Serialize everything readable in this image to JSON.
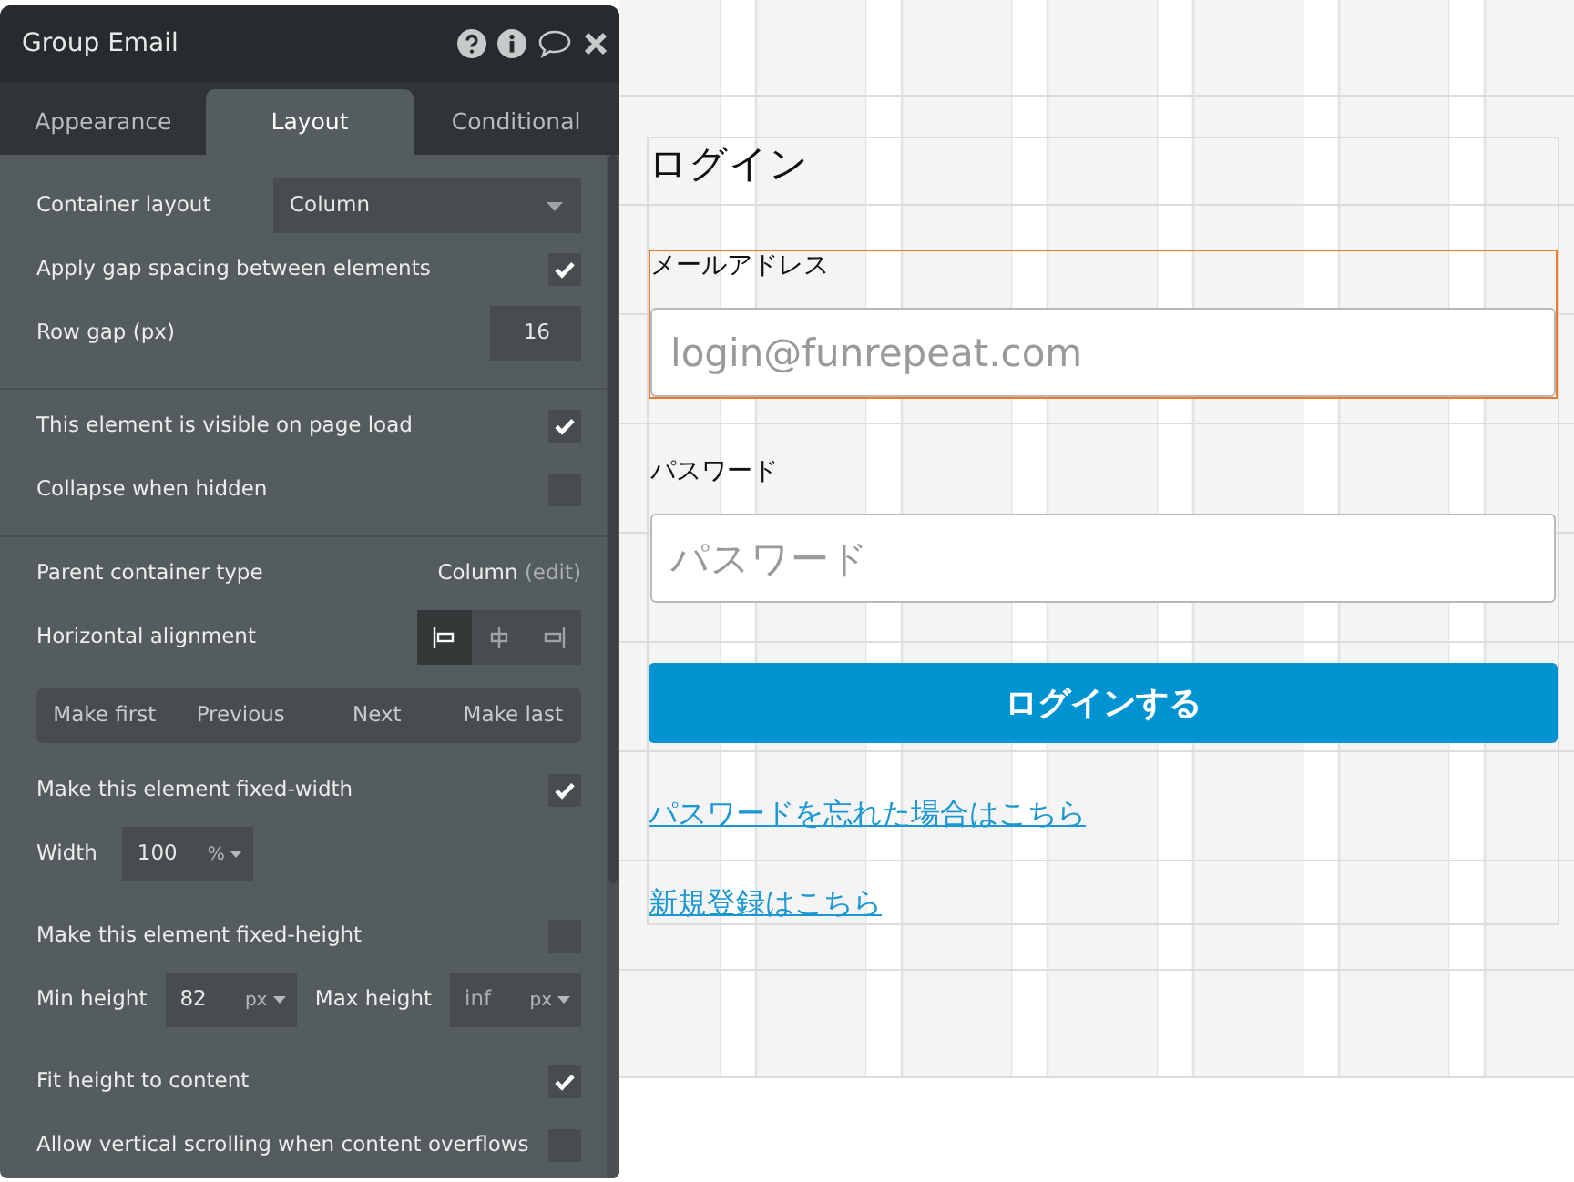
{
  "panel": {
    "title": "Group Email",
    "tabs": [
      {
        "label": "Appearance",
        "selected": false
      },
      {
        "label": "Layout",
        "selected": true
      },
      {
        "label": "Conditional",
        "selected": false
      }
    ],
    "rows": [
      {
        "kind": "select",
        "label": "Container layout",
        "value": "Column"
      },
      {
        "kind": "checkbox",
        "label": "Apply gap spacing between elements",
        "checked": true
      },
      {
        "kind": "number",
        "label": "Row gap (px)",
        "value": "16"
      },
      {
        "kind": "divider"
      },
      {
        "kind": "checkbox",
        "label": "This element is visible on page load",
        "checked": true
      },
      {
        "kind": "checkbox",
        "label": "Collapse when hidden",
        "checked": false
      },
      {
        "kind": "divider"
      },
      {
        "kind": "text",
        "label": "Parent container type",
        "value": "Column",
        "link": "(edit)"
      },
      {
        "kind": "alignment",
        "label": "Horizontal alignment",
        "options": [
          {
            "kind": "left",
            "selected": true
          },
          {
            "kind": "center",
            "selected": false
          },
          {
            "kind": "right",
            "selected": false
          }
        ]
      },
      {
        "kind": "buttons",
        "buttons": [
          "Make first",
          "Previous",
          "Next",
          "Make last"
        ]
      },
      {
        "kind": "checkbox",
        "label": "Make this element fixed-width",
        "checked": true
      },
      {
        "kind": "unit",
        "label": "Width",
        "value": "100",
        "unit": "%"
      },
      {
        "kind": "checkbox",
        "label": "Make this element fixed-height",
        "checked": false
      },
      {
        "kind": "minmax",
        "fields": [
          {
            "label": "Min height",
            "value": "82",
            "unit": "px"
          },
          {
            "label": "Max height",
            "placeholder": "inf",
            "unit": "px"
          }
        ]
      },
      {
        "kind": "checkbox",
        "label": "Fit height to content",
        "checked": true
      },
      {
        "kind": "checkbox",
        "label": "Allow vertical scrolling when content overflows",
        "checked": false
      }
    ]
  },
  "canvas": {
    "title": "ログイン",
    "fields": [
      {
        "label": "メールアドレス",
        "placeholder": "login@funrepeat.com",
        "selected": true
      },
      {
        "label": "パスワード",
        "placeholder": "パスワード",
        "selected": false
      }
    ],
    "button": "ログインする",
    "links": [
      "パスワードを忘れた場合はこちら",
      "新規登録はこちら"
    ]
  }
}
